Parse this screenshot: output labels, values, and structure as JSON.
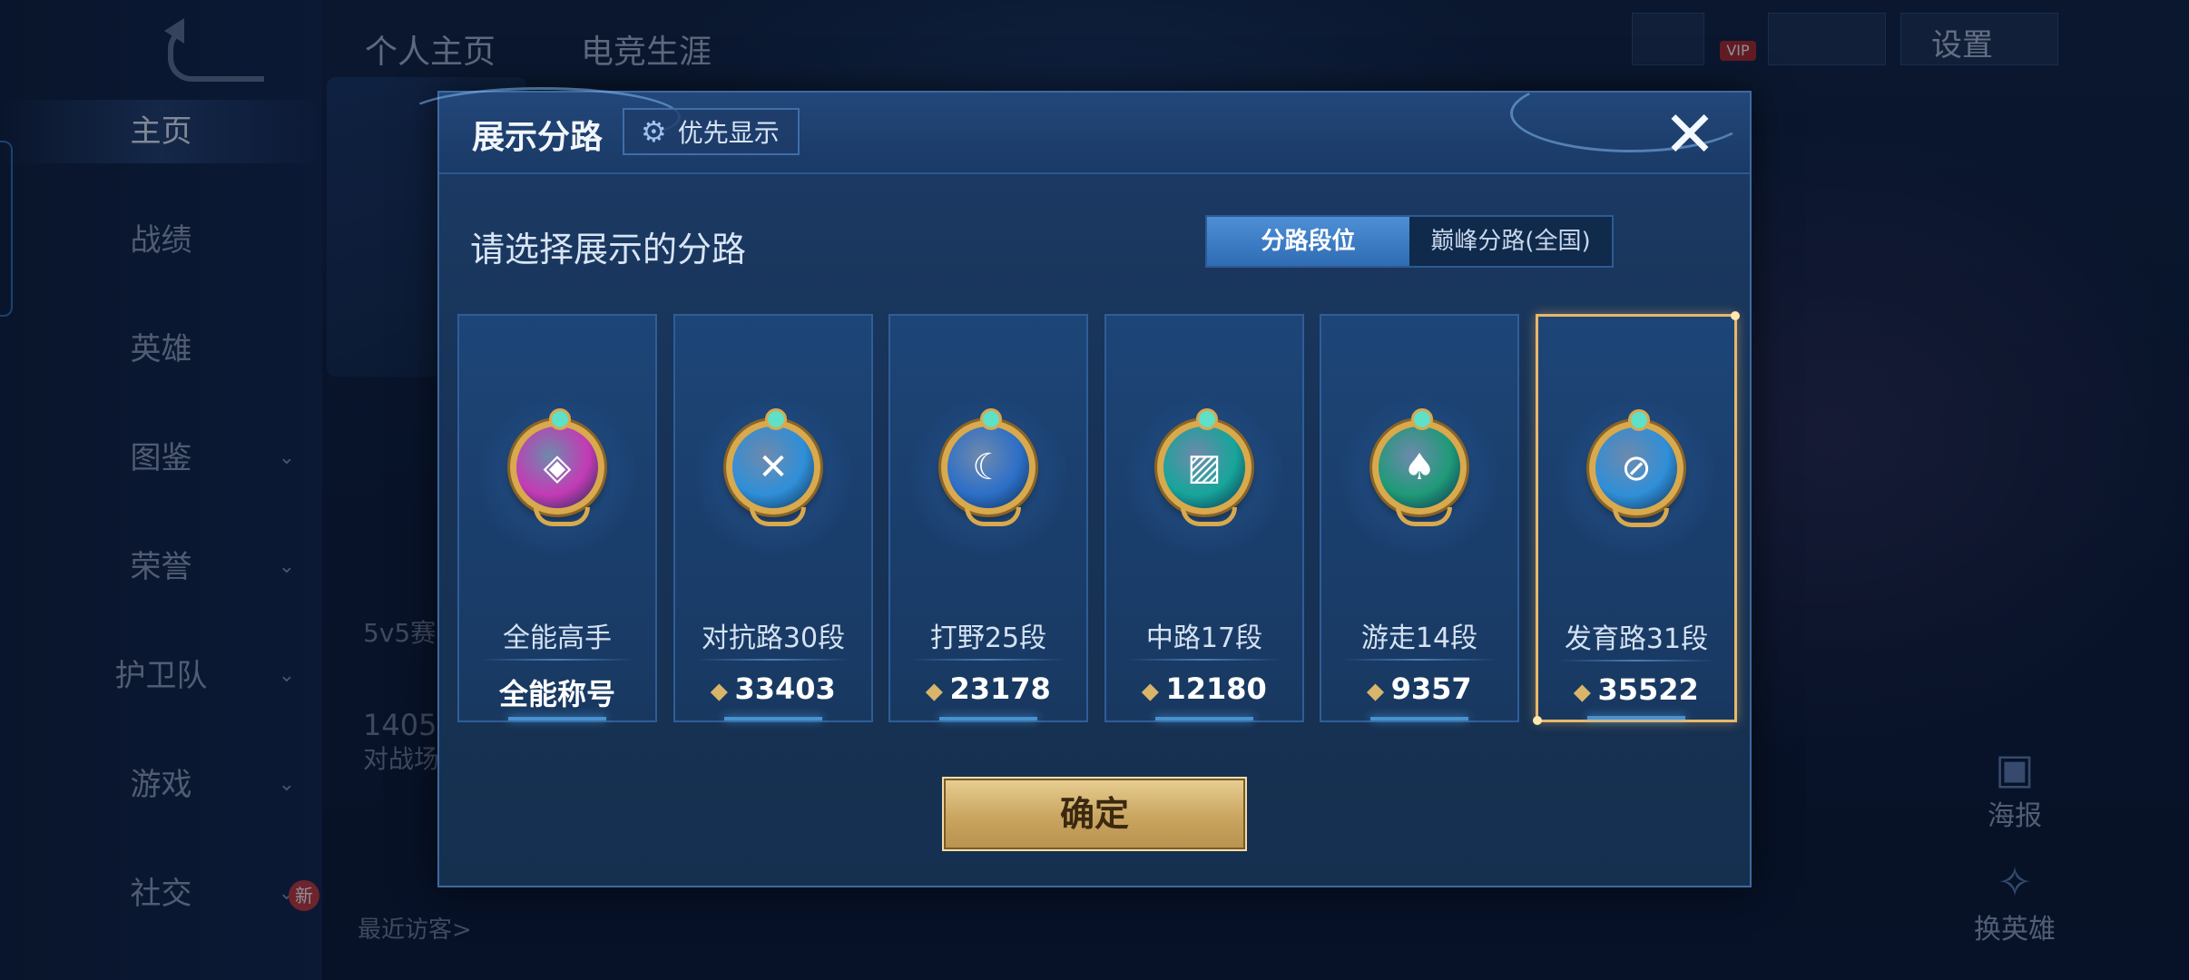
{
  "background": {
    "top_tabs": [
      "个人主页",
      "电竞生涯"
    ],
    "settings_label": "设置",
    "vip_label": "VIP",
    "sidebar": [
      {
        "label": "主页",
        "active": true,
        "caret": false
      },
      {
        "label": "战绩",
        "active": false,
        "caret": false
      },
      {
        "label": "英雄",
        "active": false,
        "caret": false
      },
      {
        "label": "图鉴",
        "active": false,
        "caret": true
      },
      {
        "label": "荣誉",
        "active": false,
        "caret": true
      },
      {
        "label": "护卫队",
        "active": false,
        "caret": true
      },
      {
        "label": "游戏",
        "active": false,
        "caret": true
      },
      {
        "label": "社交",
        "active": false,
        "caret": true
      }
    ],
    "new_badge": "新",
    "partial_texts": {
      "mode": "5v5赛",
      "count": "1405",
      "battlefield": "对战场",
      "visitors": "最近访客>"
    },
    "right_buttons": {
      "poster": "海报",
      "swap_hero": "换英雄"
    },
    "caret_icon": "chevron-down-icon"
  },
  "dialog": {
    "title": "展示分路",
    "priority_button": "优先显示",
    "gear_icon": "gear-icon",
    "prompt": "请选择展示的分路",
    "segments": [
      {
        "label": "分路段位",
        "selected": true
      },
      {
        "label": "巅峰分路(全国)",
        "selected": false
      }
    ],
    "cards": [
      {
        "name": "全能高手",
        "score": "全能称号",
        "has_score_icon": false,
        "emblem_color": "#c43bb5",
        "emblem_glyph": "◈",
        "selected": false
      },
      {
        "name": "对抗路30段",
        "score": "33403",
        "has_score_icon": true,
        "emblem_color": "#2f8fd8",
        "emblem_glyph": "✕",
        "selected": false
      },
      {
        "name": "打野25段",
        "score": "23178",
        "has_score_icon": true,
        "emblem_color": "#2d6fc8",
        "emblem_glyph": "☾",
        "selected": false
      },
      {
        "name": "中路17段",
        "score": "12180",
        "has_score_icon": true,
        "emblem_color": "#17a59a",
        "emblem_glyph": "▨",
        "selected": false
      },
      {
        "name": "游走14段",
        "score": "9357",
        "has_score_icon": true,
        "emblem_color": "#1f9a78",
        "emblem_glyph": "♠",
        "selected": false
      },
      {
        "name": "发育路31段",
        "score": "35522",
        "has_score_icon": true,
        "emblem_color": "#2f8fd8",
        "emblem_glyph": "⊘",
        "selected": true
      }
    ],
    "confirm_label": "确定"
  }
}
